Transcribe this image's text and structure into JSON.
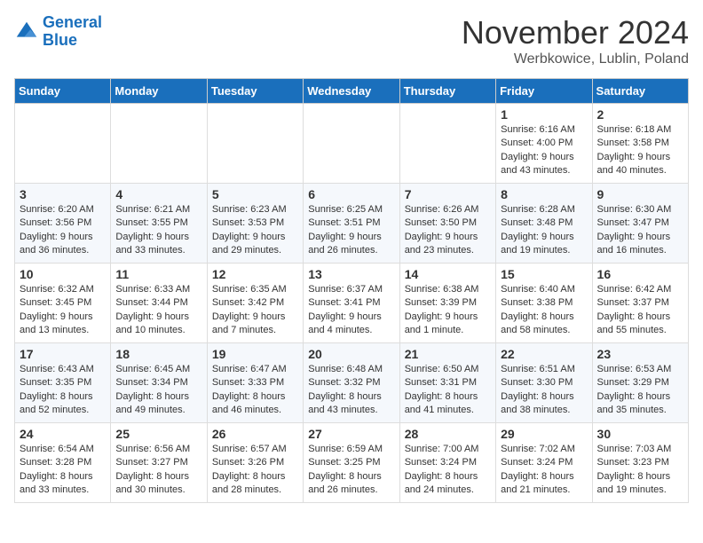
{
  "header": {
    "logo_line1": "General",
    "logo_line2": "Blue",
    "month_title": "November 2024",
    "location": "Werbkowice, Lublin, Poland"
  },
  "days_of_week": [
    "Sunday",
    "Monday",
    "Tuesday",
    "Wednesday",
    "Thursday",
    "Friday",
    "Saturday"
  ],
  "weeks": [
    [
      {
        "day": "",
        "info": ""
      },
      {
        "day": "",
        "info": ""
      },
      {
        "day": "",
        "info": ""
      },
      {
        "day": "",
        "info": ""
      },
      {
        "day": "",
        "info": ""
      },
      {
        "day": "1",
        "info": "Sunrise: 6:16 AM\nSunset: 4:00 PM\nDaylight: 9 hours\nand 43 minutes."
      },
      {
        "day": "2",
        "info": "Sunrise: 6:18 AM\nSunset: 3:58 PM\nDaylight: 9 hours\nand 40 minutes."
      }
    ],
    [
      {
        "day": "3",
        "info": "Sunrise: 6:20 AM\nSunset: 3:56 PM\nDaylight: 9 hours\nand 36 minutes."
      },
      {
        "day": "4",
        "info": "Sunrise: 6:21 AM\nSunset: 3:55 PM\nDaylight: 9 hours\nand 33 minutes."
      },
      {
        "day": "5",
        "info": "Sunrise: 6:23 AM\nSunset: 3:53 PM\nDaylight: 9 hours\nand 29 minutes."
      },
      {
        "day": "6",
        "info": "Sunrise: 6:25 AM\nSunset: 3:51 PM\nDaylight: 9 hours\nand 26 minutes."
      },
      {
        "day": "7",
        "info": "Sunrise: 6:26 AM\nSunset: 3:50 PM\nDaylight: 9 hours\nand 23 minutes."
      },
      {
        "day": "8",
        "info": "Sunrise: 6:28 AM\nSunset: 3:48 PM\nDaylight: 9 hours\nand 19 minutes."
      },
      {
        "day": "9",
        "info": "Sunrise: 6:30 AM\nSunset: 3:47 PM\nDaylight: 9 hours\nand 16 minutes."
      }
    ],
    [
      {
        "day": "10",
        "info": "Sunrise: 6:32 AM\nSunset: 3:45 PM\nDaylight: 9 hours\nand 13 minutes."
      },
      {
        "day": "11",
        "info": "Sunrise: 6:33 AM\nSunset: 3:44 PM\nDaylight: 9 hours\nand 10 minutes."
      },
      {
        "day": "12",
        "info": "Sunrise: 6:35 AM\nSunset: 3:42 PM\nDaylight: 9 hours\nand 7 minutes."
      },
      {
        "day": "13",
        "info": "Sunrise: 6:37 AM\nSunset: 3:41 PM\nDaylight: 9 hours\nand 4 minutes."
      },
      {
        "day": "14",
        "info": "Sunrise: 6:38 AM\nSunset: 3:39 PM\nDaylight: 9 hours\nand 1 minute."
      },
      {
        "day": "15",
        "info": "Sunrise: 6:40 AM\nSunset: 3:38 PM\nDaylight: 8 hours\nand 58 minutes."
      },
      {
        "day": "16",
        "info": "Sunrise: 6:42 AM\nSunset: 3:37 PM\nDaylight: 8 hours\nand 55 minutes."
      }
    ],
    [
      {
        "day": "17",
        "info": "Sunrise: 6:43 AM\nSunset: 3:35 PM\nDaylight: 8 hours\nand 52 minutes."
      },
      {
        "day": "18",
        "info": "Sunrise: 6:45 AM\nSunset: 3:34 PM\nDaylight: 8 hours\nand 49 minutes."
      },
      {
        "day": "19",
        "info": "Sunrise: 6:47 AM\nSunset: 3:33 PM\nDaylight: 8 hours\nand 46 minutes."
      },
      {
        "day": "20",
        "info": "Sunrise: 6:48 AM\nSunset: 3:32 PM\nDaylight: 8 hours\nand 43 minutes."
      },
      {
        "day": "21",
        "info": "Sunrise: 6:50 AM\nSunset: 3:31 PM\nDaylight: 8 hours\nand 41 minutes."
      },
      {
        "day": "22",
        "info": "Sunrise: 6:51 AM\nSunset: 3:30 PM\nDaylight: 8 hours\nand 38 minutes."
      },
      {
        "day": "23",
        "info": "Sunrise: 6:53 AM\nSunset: 3:29 PM\nDaylight: 8 hours\nand 35 minutes."
      }
    ],
    [
      {
        "day": "24",
        "info": "Sunrise: 6:54 AM\nSunset: 3:28 PM\nDaylight: 8 hours\nand 33 minutes."
      },
      {
        "day": "25",
        "info": "Sunrise: 6:56 AM\nSunset: 3:27 PM\nDaylight: 8 hours\nand 30 minutes."
      },
      {
        "day": "26",
        "info": "Sunrise: 6:57 AM\nSunset: 3:26 PM\nDaylight: 8 hours\nand 28 minutes."
      },
      {
        "day": "27",
        "info": "Sunrise: 6:59 AM\nSunset: 3:25 PM\nDaylight: 8 hours\nand 26 minutes."
      },
      {
        "day": "28",
        "info": "Sunrise: 7:00 AM\nSunset: 3:24 PM\nDaylight: 8 hours\nand 24 minutes."
      },
      {
        "day": "29",
        "info": "Sunrise: 7:02 AM\nSunset: 3:24 PM\nDaylight: 8 hours\nand 21 minutes."
      },
      {
        "day": "30",
        "info": "Sunrise: 7:03 AM\nSunset: 3:23 PM\nDaylight: 8 hours\nand 19 minutes."
      }
    ]
  ]
}
